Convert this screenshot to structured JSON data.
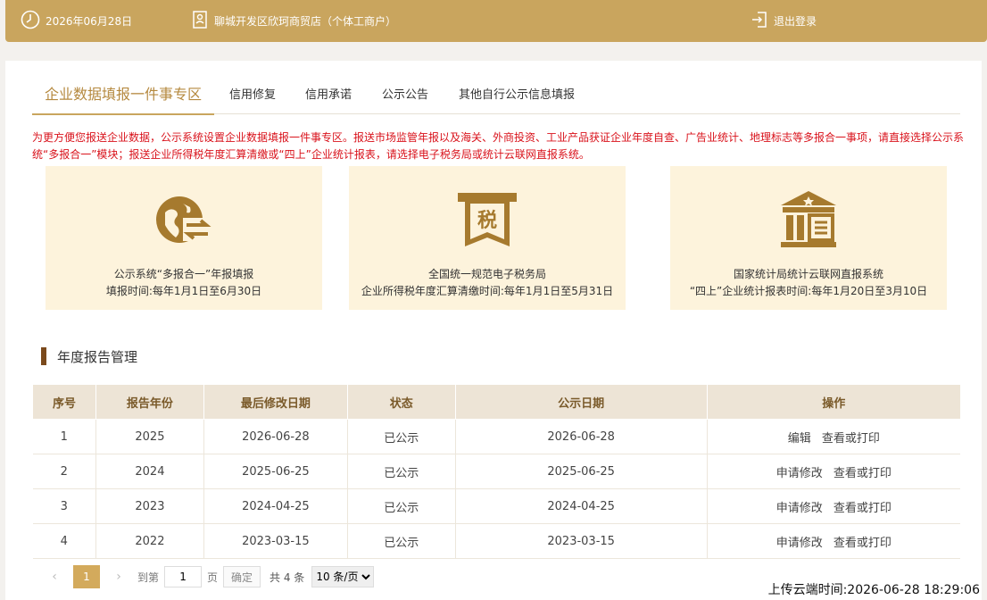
{
  "header": {
    "date": "2026年06月28日",
    "shop_name": "聊城开发区欣珂商贸店（个体工商户）",
    "logout": "退出登录"
  },
  "tabs": [
    {
      "label": "企业数据填报一件事专区",
      "active": true
    },
    {
      "label": "信用修复"
    },
    {
      "label": "信用承诺"
    },
    {
      "label": "公示公告"
    },
    {
      "label": "其他自行公示信息填报"
    }
  ],
  "notice": "为更方便您报送企业数据，公示系统设置企业数据填报一件事专区。报送市场监管年报以及海关、外商投资、工业产品获证企业年度自查、广告业统计、地理标志等多报合一事项，请直接选择公示系统“多报合一”模块；报送企业所得税年度汇算清缴或“四上”企业统计报表，请选择电子税务局或统计云联网直报系统。",
  "cards": [
    {
      "icon": "globe-exchange-icon",
      "line1": "公示系统“多报合一”年报填报",
      "line2": "填报时间:每年1月1日至6月30日"
    },
    {
      "icon": "tax-ribbon-icon",
      "ribbon_text": "税",
      "line1": "全国统一规范电子税务局",
      "line2": "企业所得税年度汇算清缴时间:每年1月1日至5月31日"
    },
    {
      "icon": "government-building-icon",
      "line1": "国家统计局统计云联网直报系统",
      "line2": "“四上”企业统计报表时间:每年1月20日至3月10日"
    }
  ],
  "section_title": "年度报告管理",
  "table": {
    "headers": [
      "序号",
      "报告年份",
      "最后修改日期",
      "状态",
      "公示日期",
      "操作"
    ],
    "rows": [
      {
        "no": "1",
        "year": "2025",
        "modified": "2026-06-28",
        "status": "已公示",
        "public_date": "2026-06-28",
        "action1": "编辑",
        "action2": "查看或打印"
      },
      {
        "no": "2",
        "year": "2024",
        "modified": "2025-06-25",
        "status": "已公示",
        "public_date": "2025-06-25",
        "action1": "申请修改",
        "action2": "查看或打印"
      },
      {
        "no": "3",
        "year": "2023",
        "modified": "2024-04-25",
        "status": "已公示",
        "public_date": "2024-04-25",
        "action1": "申请修改",
        "action2": "查看或打印"
      },
      {
        "no": "4",
        "year": "2022",
        "modified": "2023-03-15",
        "status": "已公示",
        "public_date": "2023-03-15",
        "action1": "申请修改",
        "action2": "查看或打印"
      }
    ]
  },
  "pager": {
    "prev": "‹",
    "current_page": "1",
    "next": "›",
    "goto_label": "到第",
    "goto_value": "1",
    "page_suffix": "页",
    "confirm": "确定",
    "total": "共 4 条",
    "per_page": "10 条/页"
  },
  "upload_time": "上传云端时间:2026-06-28 18:29:06",
  "colors": {
    "gold": "#c9a55e",
    "notice_red": "#d9121b",
    "card_bg": "#fdf3dc",
    "icon_brown": "#a67a2e"
  }
}
